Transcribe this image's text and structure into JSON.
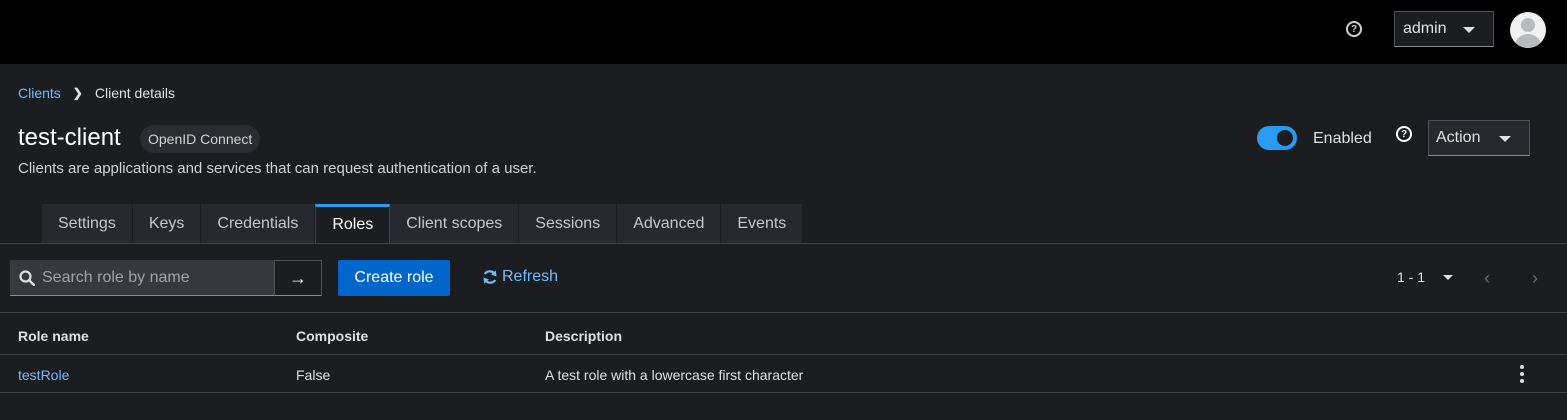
{
  "masthead": {
    "help_glyph": "?",
    "user_menu_label": "admin"
  },
  "breadcrumb": {
    "parent": "Clients",
    "current": "Client details"
  },
  "header": {
    "title": "test-client",
    "protocol_badge": "OpenID Connect",
    "subtitle": "Clients are applications and services that can request authentication of a user.",
    "enabled_label": "Enabled",
    "enabled": true,
    "help_glyph": "?",
    "action_label": "Action"
  },
  "tabs": [
    {
      "label": "Settings"
    },
    {
      "label": "Keys"
    },
    {
      "label": "Credentials"
    },
    {
      "label": "Roles",
      "active": true
    },
    {
      "label": "Client scopes"
    },
    {
      "label": "Sessions"
    },
    {
      "label": "Advanced"
    },
    {
      "label": "Events"
    }
  ],
  "toolbar": {
    "search_placeholder": "Search role by name",
    "search_go_glyph": "→",
    "create_label": "Create role",
    "refresh_label": "Refresh",
    "pagination": "1 - 1",
    "prev_glyph": "‹",
    "next_glyph": "›"
  },
  "table": {
    "columns": [
      "Role name",
      "Composite",
      "Description"
    ],
    "rows": [
      {
        "name": "testRole",
        "composite": "False",
        "description": "A test role with a lowercase first character"
      }
    ]
  },
  "colors": {
    "accent": "#2b9af3",
    "link": "#73bcf7",
    "primary_button": "#0066cc",
    "background": "#1b1d21",
    "masthead": "#000000"
  },
  "icons": [
    "help-icon",
    "caret-down-icon",
    "avatar-icon",
    "chevron-right-icon",
    "search-icon",
    "arrow-right-icon",
    "sync-icon",
    "angle-left-icon",
    "angle-right-icon",
    "kebab-icon"
  ]
}
